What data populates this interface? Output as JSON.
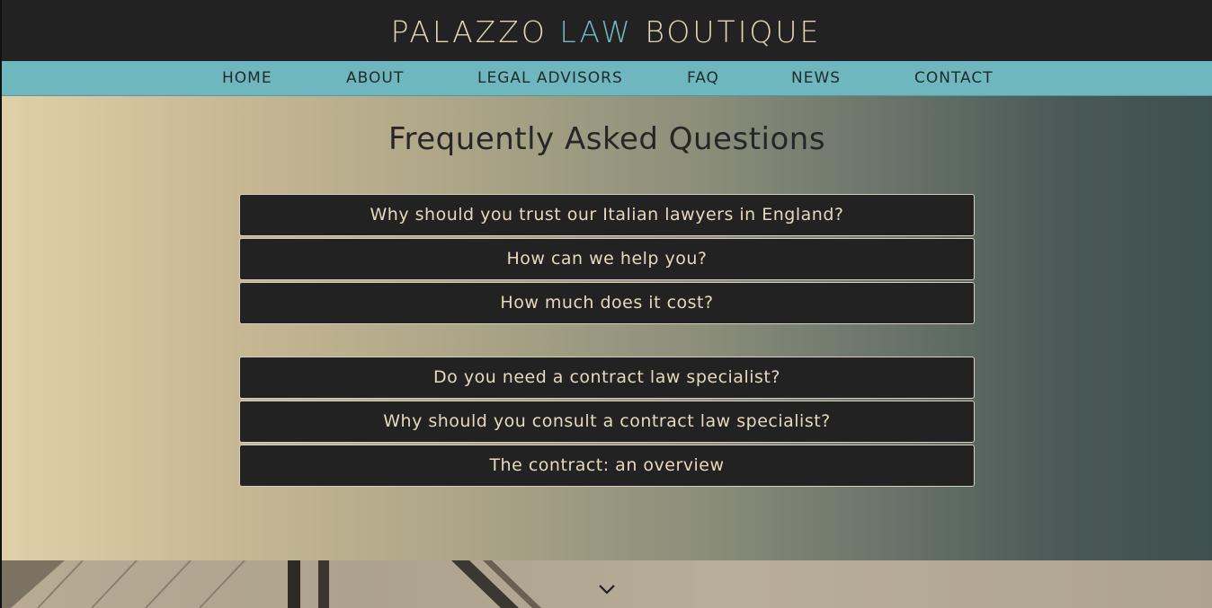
{
  "header": {
    "brand_part1": "PALAZZO ",
    "brand_accent": "LAW",
    "brand_part2": " BOUTIQUE"
  },
  "nav": {
    "items": [
      "HOME",
      "ABOUT",
      "LEGAL ADVISORS",
      "FAQ",
      "NEWS",
      "CONTACT"
    ]
  },
  "faq": {
    "title": "Frequently Asked Questions",
    "group1": [
      "Why should you trust our Italian lawyers in England?",
      "How can we help you?",
      "How much does it cost?"
    ],
    "group2": [
      "Do you need a contract law specialist?",
      "Why should you consult a contract law specialist?",
      "The contract: an overview"
    ]
  },
  "icons": {
    "scroll_down": "chevron-down-icon"
  },
  "colors": {
    "header_bg": "#222222",
    "brand_text": "#e3d4b4",
    "brand_accent": "#6fb7bf",
    "nav_bg": "#6fb7bf",
    "faq_button_bg": "#222222",
    "faq_button_text": "#e6d9bd"
  }
}
